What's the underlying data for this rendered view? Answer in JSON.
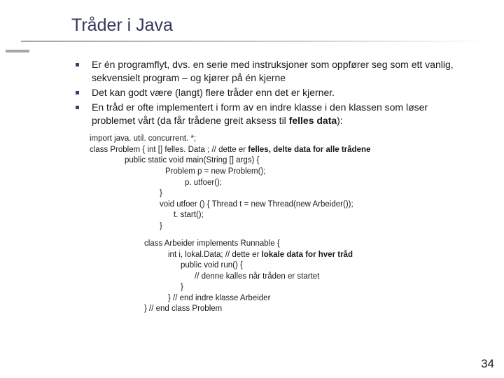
{
  "title": "Tråder i Java",
  "bullets": [
    "Er én programflyt, dvs. en serie med instruksjoner som oppfører seg som ett vanlig, sekvensielt program – og kjører på én kjerne",
    "Det kan godt være (langt) flere tråder enn det er kjerner.",
    "En tråd er ofte implementert i form av en indre klasse i den klassen som løser problemet vårt (da får trådene greit aksess til "
  ],
  "bullet3_bold": "felles data",
  "bullet3_tail": "):",
  "code1": {
    "l1": "import java. util. concurrent. *;",
    "l2a": "class Problem { int [] felles. Data ; // dette er ",
    "l2b": "felles, delte data for alle trådene",
    "l3": "public static void main(String [] args) {",
    "l4": "Problem p = new Problem();",
    "l5": "p. utfoer();",
    "l6": "}",
    "l7": "void utfoer () { Thread  t = new Thread(new Arbeider());",
    "l8": "t. start();",
    "l9": "}"
  },
  "code2": {
    "l1": "class Arbeider implements Runnable {",
    "l2a": "int i, lokal.Data; // dette er ",
    "l2b": "lokale data for hver tråd",
    "l3": "public void run() {",
    "l4": "// denne kalles når tråden er startet",
    "l5": "}",
    "l6": "} // end indre klasse Arbeider",
    "l7": "} // end class Problem"
  },
  "pagenum": "34"
}
